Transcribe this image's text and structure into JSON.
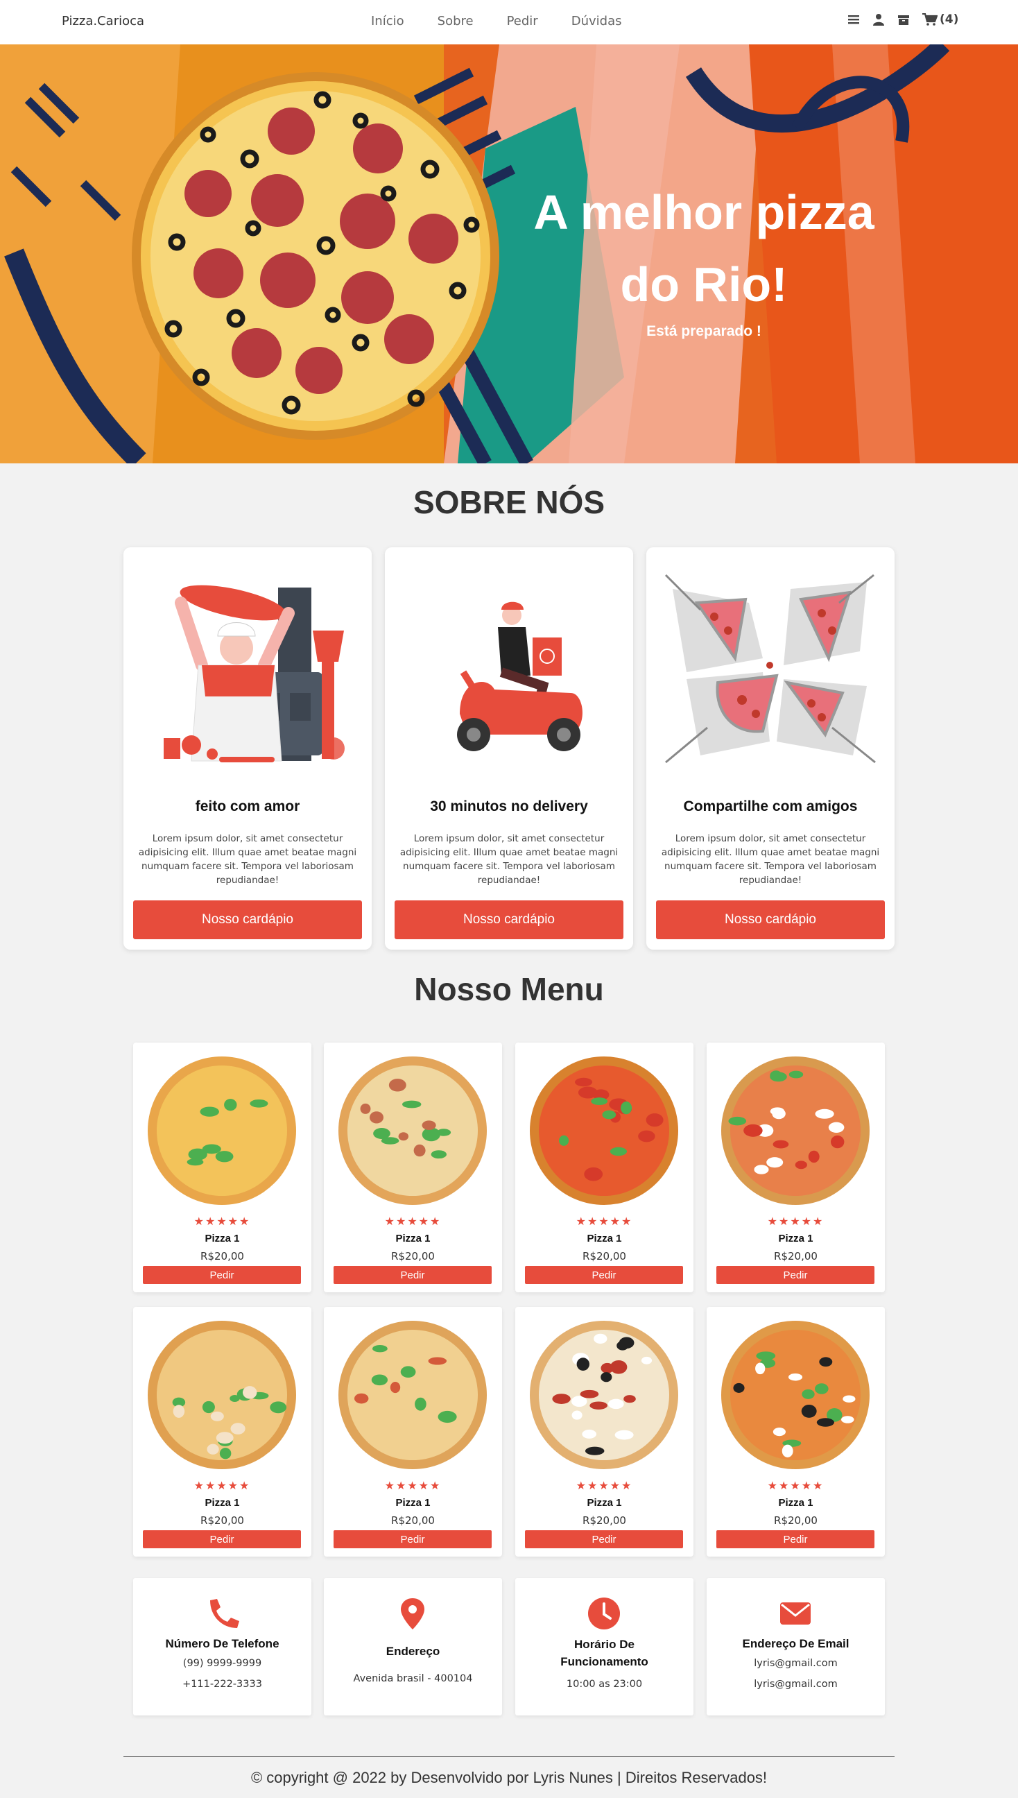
{
  "nav": {
    "brand": "Pizza.Carioca",
    "links": [
      "Início",
      "Sobre",
      "Pedir",
      "Dúvidas"
    ],
    "cart_count": "(4)",
    "icons": [
      "menu-icon",
      "user-icon",
      "box-icon",
      "cart-icon"
    ]
  },
  "hero": {
    "title_line1": "A melhor pizza",
    "title_line2": "do Rio!",
    "subtitle": "Está preparado !"
  },
  "about": {
    "title": "SOBRE NÓS",
    "cards": [
      {
        "title": "feito com amor",
        "text": "Lorem ipsum dolor, sit amet consectetur adipisicing elit. Illum quae amet beatae magni numquam facere sit. Tempora vel laboriosam repudiandae!",
        "button": "Nosso cardápio"
      },
      {
        "title": "30 minutos no delivery",
        "text": "Lorem ipsum dolor, sit amet consectetur adipisicing elit. Illum quae amet beatae magni numquam facere sit. Tempora vel laboriosam repudiandae!",
        "button": "Nosso cardápio"
      },
      {
        "title": "Compartilhe com amigos",
        "text": "Lorem ipsum dolor, sit amet consectetur adipisicing elit. Illum quae amet beatae magni numquam facere sit. Tempora vel laboriosam repudiandae!",
        "button": "Nosso cardápio"
      }
    ]
  },
  "menu": {
    "title": "Nosso Menu",
    "items": [
      {
        "name": "Pizza 1",
        "price": "R$20,00",
        "button": "Pedir",
        "rating": 5
      },
      {
        "name": "Pizza 1",
        "price": "R$20,00",
        "button": "Pedir",
        "rating": 5
      },
      {
        "name": "Pizza 1",
        "price": "R$20,00",
        "button": "Pedir",
        "rating": 5
      },
      {
        "name": "Pizza 1",
        "price": "R$20,00",
        "button": "Pedir",
        "rating": 5
      },
      {
        "name": "Pizza 1",
        "price": "R$20,00",
        "button": "Pedir",
        "rating": 5
      },
      {
        "name": "Pizza 1",
        "price": "R$20,00",
        "button": "Pedir",
        "rating": 5
      },
      {
        "name": "Pizza 1",
        "price": "R$20,00",
        "button": "Pedir",
        "rating": 5
      },
      {
        "name": "Pizza 1",
        "price": "R$20,00",
        "button": "Pedir",
        "rating": 5
      }
    ]
  },
  "contact": [
    {
      "icon": "phone-icon",
      "title": "Número De Telefone",
      "lines": [
        "(99) 9999-9999",
        "+111-222-3333"
      ]
    },
    {
      "icon": "location-icon",
      "title": "Endereço",
      "lines": [
        "Avenida brasil - 400104"
      ]
    },
    {
      "icon": "clock-icon",
      "title_line1": "Horário De",
      "title_line2": "Funcionamento",
      "lines": [
        "10:00 as 23:00"
      ]
    },
    {
      "icon": "envelope-icon",
      "title": "Endereço De Email",
      "lines": [
        "lyris@gmail.com",
        "lyris@gmail.com"
      ]
    }
  ],
  "footer": {
    "text": "© copyright @ 2022 by Desenvolvido por Lyris Nunes | Direitos Reservados!"
  },
  "colors": {
    "accent": "#e74c3c",
    "background": "#f2f2f2"
  }
}
